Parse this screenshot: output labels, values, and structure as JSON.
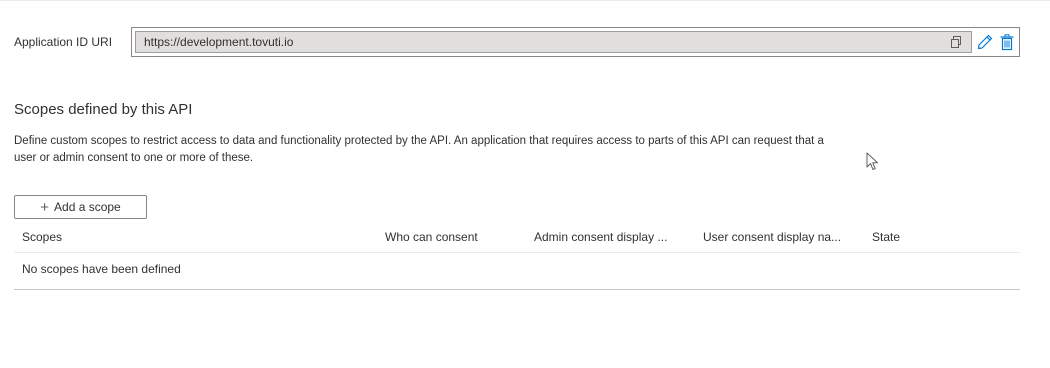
{
  "app_id_uri": {
    "label": "Application ID URI",
    "value": "https://development.tovuti.io",
    "icons": [
      "copy-icon",
      "pencil-edit-icon",
      "trash-delete-icon"
    ],
    "accent_color": "#0078d4"
  },
  "scopes_section": {
    "title": "Scopes defined by this API",
    "description": "Define custom scopes to restrict access to data and functionality protected by the API. An application that requires access to parts of this API can request that a user or admin consent to one or more of these.",
    "add_button": {
      "icon": "plus-icon",
      "label": "Add a scope"
    },
    "table": {
      "columns": [
        "Scopes",
        "Who can consent",
        "Admin consent display ...",
        "User consent display na...",
        "State"
      ],
      "empty_message": "No scopes have been defined"
    }
  }
}
